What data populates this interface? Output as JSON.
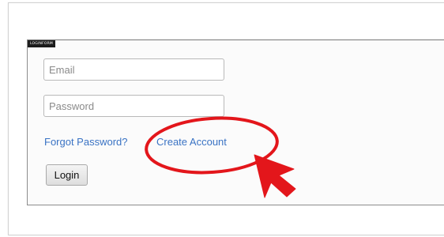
{
  "login_form": {
    "tag_label": "LOGINFORM",
    "email_placeholder": "Email",
    "password_placeholder": "Password",
    "forgot_password_label": "Forgot Password?",
    "create_account_label": "Create Account",
    "login_button_label": "Login"
  },
  "annotation": {
    "highlight_color": "#e3161b",
    "circle_target": "create-account-link",
    "pointer_icon": "arrow-cursor-icon"
  }
}
